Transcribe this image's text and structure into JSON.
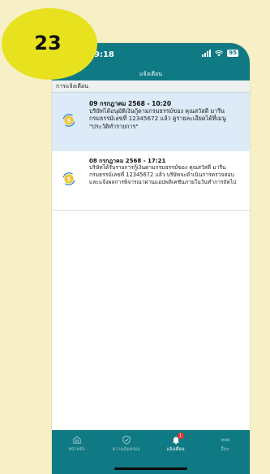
{
  "badge": {
    "number": "23"
  },
  "status": {
    "time": "9:18",
    "battery": "95"
  },
  "header": {
    "title": "แจ้งเตือน"
  },
  "section": {
    "label": "การแจ้งเตือน"
  },
  "notifications": [
    {
      "date": "09 กรกฎาคม 2568 - 10:20",
      "text": "บริษัทได้อนุมัติเงินกู้ตามกรมธรรม์ของ คุณสวัสดี มารีน กรมธรรม์เลขที่ 12345672 แล้ว ดูรายละเอียดได้ที่เมนู \"ประวัติทำรายการ\"",
      "icon": "coin-refresh-icon"
    },
    {
      "date": "08 กรกฎาคม 2568 - 17:21",
      "text": "บริษัทได้รับรายการกู้เงินตามกรมธรรม์ของ คุณสวัสดี มารีน กรมธรรม์เลขที่ 12345672 แล้ว บริษัทจะดำเนินการตรวจสอบและแจ้งผลการพิจารณาผ่านแอปพลิเคชันภายในวันทำการถัดไป",
      "icon": "coin-refresh-icon"
    }
  ],
  "tabs": [
    {
      "label": "หน้าหลัก",
      "icon": "home-icon"
    },
    {
      "label": "ความคุ้มครอง",
      "icon": "shield-check-icon"
    },
    {
      "label": "แจ้งเตือน",
      "icon": "bell-icon",
      "badge": "1"
    },
    {
      "label": "อื่นๆ",
      "icon": "more-dots-icon"
    }
  ],
  "colors": {
    "primary": "#0f7a84",
    "highlight": "#dcebf7",
    "badge": "#e7e21d",
    "background": "#f7efc6"
  }
}
